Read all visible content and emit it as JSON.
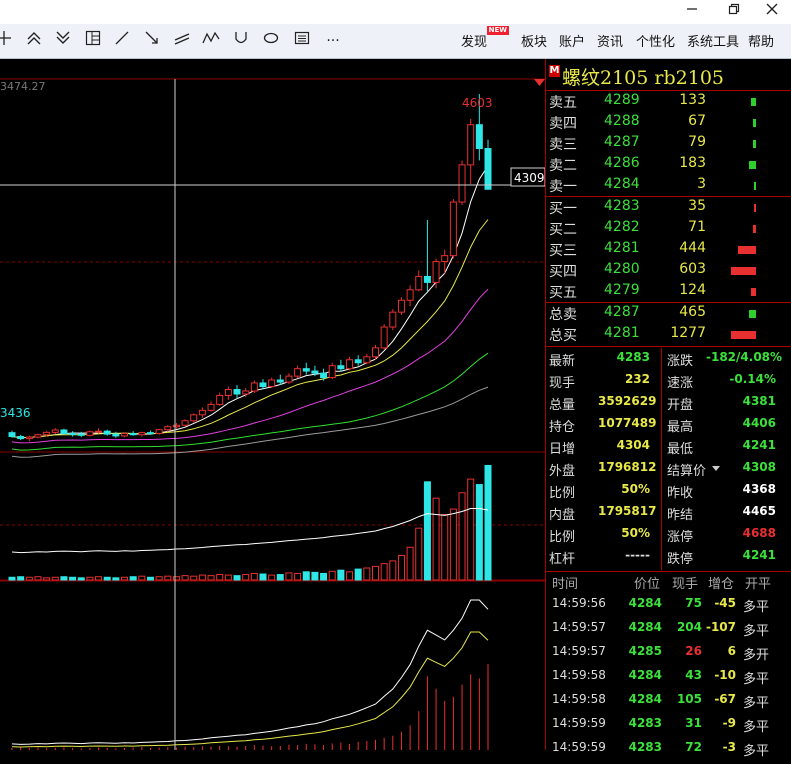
{
  "window": {
    "min_icon": "minimize-icon",
    "restore_icon": "restore-icon",
    "close_icon": "close-icon"
  },
  "toolbar": {
    "tools": [
      "crosshair-icon",
      "double-up-icon",
      "double-down-icon",
      "layout-icon",
      "line-icon",
      "arrow-line-icon",
      "parallel-lines-icon",
      "wave-icon",
      "u-shape-icon",
      "ellipse-icon",
      "text-box-icon",
      "more-icon"
    ],
    "more_label": "···",
    "menu": [
      {
        "label": "发现",
        "badge": "NEW"
      },
      {
        "label": "板块"
      },
      {
        "label": "账户"
      },
      {
        "label": "资讯"
      },
      {
        "label": "个性化"
      },
      {
        "label": "系统工具"
      },
      {
        "label": "帮助"
      }
    ]
  },
  "chart": {
    "top_price_label": "3474.27",
    "high_label": "4603",
    "low_label": "3436",
    "crosshair_price": "4309",
    "ylim": [
      3400,
      4620
    ],
    "candles": [
      [
        3465,
        3472,
        3448,
        3452
      ],
      [
        3452,
        3458,
        3440,
        3445
      ],
      [
        3445,
        3455,
        3436,
        3450
      ],
      [
        3450,
        3462,
        3446,
        3458
      ],
      [
        3458,
        3470,
        3452,
        3466
      ],
      [
        3466,
        3480,
        3460,
        3474
      ],
      [
        3474,
        3478,
        3458,
        3462
      ],
      [
        3462,
        3470,
        3452,
        3460
      ],
      [
        3460,
        3468,
        3450,
        3456
      ],
      [
        3456,
        3472,
        3452,
        3468
      ],
      [
        3468,
        3480,
        3462,
        3470
      ],
      [
        3470,
        3475,
        3455,
        3460
      ],
      [
        3460,
        3468,
        3448,
        3454
      ],
      [
        3454,
        3466,
        3450,
        3462
      ],
      [
        3462,
        3470,
        3455,
        3458
      ],
      [
        3458,
        3468,
        3452,
        3465
      ],
      [
        3465,
        3472,
        3458,
        3462
      ],
      [
        3462,
        3478,
        3458,
        3475
      ],
      [
        3475,
        3490,
        3468,
        3485
      ],
      [
        3485,
        3498,
        3478,
        3490
      ],
      [
        3490,
        3510,
        3485,
        3505
      ],
      [
        3505,
        3530,
        3498,
        3525
      ],
      [
        3525,
        3550,
        3515,
        3540
      ],
      [
        3540,
        3570,
        3535,
        3560
      ],
      [
        3560,
        3600,
        3555,
        3590
      ],
      [
        3590,
        3620,
        3575,
        3610
      ],
      [
        3610,
        3625,
        3580,
        3595
      ],
      [
        3595,
        3615,
        3585,
        3605
      ],
      [
        3605,
        3640,
        3598,
        3632
      ],
      [
        3632,
        3645,
        3610,
        3620
      ],
      [
        3620,
        3650,
        3615,
        3642
      ],
      [
        3642,
        3660,
        3625,
        3635
      ],
      [
        3635,
        3665,
        3628,
        3655
      ],
      [
        3655,
        3690,
        3648,
        3680
      ],
      [
        3680,
        3700,
        3660,
        3672
      ],
      [
        3672,
        3690,
        3655,
        3665
      ],
      [
        3665,
        3680,
        3640,
        3650
      ],
      [
        3650,
        3700,
        3645,
        3690
      ],
      [
        3690,
        3710,
        3670,
        3680
      ],
      [
        3680,
        3720,
        3675,
        3710
      ],
      [
        3710,
        3725,
        3690,
        3700
      ],
      [
        3700,
        3730,
        3695,
        3720
      ],
      [
        3720,
        3760,
        3710,
        3750
      ],
      [
        3750,
        3830,
        3745,
        3820
      ],
      [
        3820,
        3880,
        3810,
        3870
      ],
      [
        3870,
        3920,
        3860,
        3910
      ],
      [
        3910,
        3960,
        3890,
        3945
      ],
      [
        3945,
        4010,
        3940,
        3990
      ],
      [
        3990,
        4180,
        3940,
        3970
      ],
      [
        3970,
        4050,
        3950,
        4040
      ],
      [
        4040,
        4080,
        4000,
        4060
      ],
      [
        4060,
        4250,
        4050,
        4240
      ],
      [
        4240,
        4380,
        4230,
        4365
      ],
      [
        4365,
        4520,
        4300,
        4500
      ],
      [
        4500,
        4603,
        4380,
        4420
      ],
      [
        4420,
        4450,
        4283,
        4283
      ]
    ],
    "volumes": [
      5,
      6,
      5,
      6,
      4,
      5,
      6,
      5,
      4,
      5,
      6,
      5,
      4,
      5,
      6,
      7,
      5,
      6,
      7,
      6,
      8,
      7,
      9,
      8,
      10,
      9,
      8,
      10,
      12,
      11,
      9,
      10,
      13,
      12,
      15,
      14,
      12,
      16,
      18,
      15,
      20,
      22,
      25,
      30,
      35,
      45,
      60,
      95,
      180,
      150,
      120,
      130,
      160,
      185,
      175,
      210
    ],
    "open_interest": [
      60,
      58,
      59,
      61,
      60,
      62,
      63,
      62,
      61,
      63,
      64,
      63,
      62,
      64,
      63,
      65,
      66,
      67,
      68,
      70,
      71,
      73,
      75,
      78,
      80,
      82,
      84,
      85,
      88,
      90,
      92,
      95,
      98,
      100,
      103,
      105,
      108,
      112,
      115,
      118,
      122,
      126,
      130,
      138,
      145,
      155,
      165,
      178,
      188,
      185,
      182,
      188,
      195,
      205,
      205,
      200
    ]
  },
  "quote": {
    "title": "螺纹2105  rb2105",
    "badge": "M",
    "asks": [
      {
        "label": "卖五",
        "price": "4289",
        "vol": "133",
        "bar": 0.2
      },
      {
        "label": "卖四",
        "price": "4288",
        "vol": "67",
        "bar": 0.1
      },
      {
        "label": "卖三",
        "price": "4287",
        "vol": "79",
        "bar": 0.12
      },
      {
        "label": "卖二",
        "price": "4286",
        "vol": "183",
        "bar": 0.28
      },
      {
        "label": "卖一",
        "price": "4284",
        "vol": "3",
        "bar": 0.01
      }
    ],
    "bids": [
      {
        "label": "买一",
        "price": "4283",
        "vol": "35",
        "bar": 0.05
      },
      {
        "label": "买二",
        "price": "4282",
        "vol": "71",
        "bar": 0.1
      },
      {
        "label": "买三",
        "price": "4281",
        "vol": "444",
        "bar": 0.7
      },
      {
        "label": "买四",
        "price": "4280",
        "vol": "603",
        "bar": 0.95
      },
      {
        "label": "买五",
        "price": "4279",
        "vol": "124",
        "bar": 0.18
      }
    ],
    "totals": [
      {
        "label": "总卖",
        "price": "4287",
        "vol": "465",
        "bar": 0.28,
        "color": "#2ed02e"
      },
      {
        "label": "总买",
        "price": "4281",
        "vol": "1277",
        "bar": 0.95,
        "color": "#e83030"
      }
    ],
    "stats": [
      {
        "l1": "最新",
        "v1": "4283",
        "c1": "#3be03b",
        "l2": "涨跌",
        "v2": "-182/4.08%",
        "c2": "#3be03b"
      },
      {
        "l1": "现手",
        "v1": "232",
        "c1": "#e8e84a",
        "l2": "速涨",
        "v2": "-0.14%",
        "c2": "#3be03b"
      },
      {
        "l1": "总量",
        "v1": "3592629",
        "c1": "#e8e84a",
        "l2": "开盘",
        "v2": "4381",
        "c2": "#3be03b"
      },
      {
        "l1": "持仓",
        "v1": "1077489",
        "c1": "#e8e84a",
        "l2": "最高",
        "v2": "4406",
        "c2": "#3be03b"
      },
      {
        "l1": "日增",
        "v1": "4304",
        "c1": "#e8e84a",
        "l2": "最低",
        "v2": "4241",
        "c2": "#3be03b"
      },
      {
        "l1": "外盘",
        "v1": "1796812",
        "c1": "#e8e84a",
        "l2": "结算价",
        "v2": "4308",
        "c2": "#3be03b"
      },
      {
        "l1": "比例",
        "v1": "50%",
        "c1": "#e8e84a",
        "l2": "昨收",
        "v2": "4368",
        "c2": "#ffffff"
      },
      {
        "l1": "内盘",
        "v1": "1795817",
        "c1": "#e8e84a",
        "l2": "昨结",
        "v2": "4465",
        "c2": "#ffffff"
      },
      {
        "l1": "比例",
        "v1": "50%",
        "c1": "#e8e84a",
        "l2": "涨停",
        "v2": "4688",
        "c2": "#e83030"
      },
      {
        "l1": "杠杆",
        "v1": "-----",
        "c1": "#dddddd",
        "l2": "跌停",
        "v2": "4241",
        "c2": "#3be03b"
      }
    ],
    "ticks_header": {
      "time": "时间",
      "price": "价位",
      "vol": "现手",
      "oi": "增仓",
      "type": "开平"
    },
    "ticks": [
      {
        "time": "14:59:56",
        "price": "4284",
        "vol": "75",
        "vc": "#3be03b",
        "oi": "-45",
        "type": "多平"
      },
      {
        "time": "14:59:57",
        "price": "4284",
        "vol": "204",
        "vc": "#3be03b",
        "oi": "-107",
        "type": "多平"
      },
      {
        "time": "14:59:57",
        "price": "4285",
        "vol": "26",
        "vc": "#e83030",
        "oi": "6",
        "type": "多开"
      },
      {
        "time": "14:59:58",
        "price": "4284",
        "vol": "43",
        "vc": "#3be03b",
        "oi": "-10",
        "type": "多平"
      },
      {
        "time": "14:59:58",
        "price": "4284",
        "vol": "105",
        "vc": "#3be03b",
        "oi": "-67",
        "type": "多平"
      },
      {
        "time": "14:59:59",
        "price": "4283",
        "vol": "31",
        "vc": "#3be03b",
        "oi": "-9",
        "type": "多平"
      },
      {
        "time": "14:59:59",
        "price": "4283",
        "vol": "72",
        "vc": "#3be03b",
        "oi": "-3",
        "type": "多平"
      }
    ],
    "colors": {
      "up": "#e83030",
      "down": "#2ee6e6",
      "green": "#3be03b",
      "yellow": "#e8e84a",
      "border": "#aa0000"
    }
  }
}
